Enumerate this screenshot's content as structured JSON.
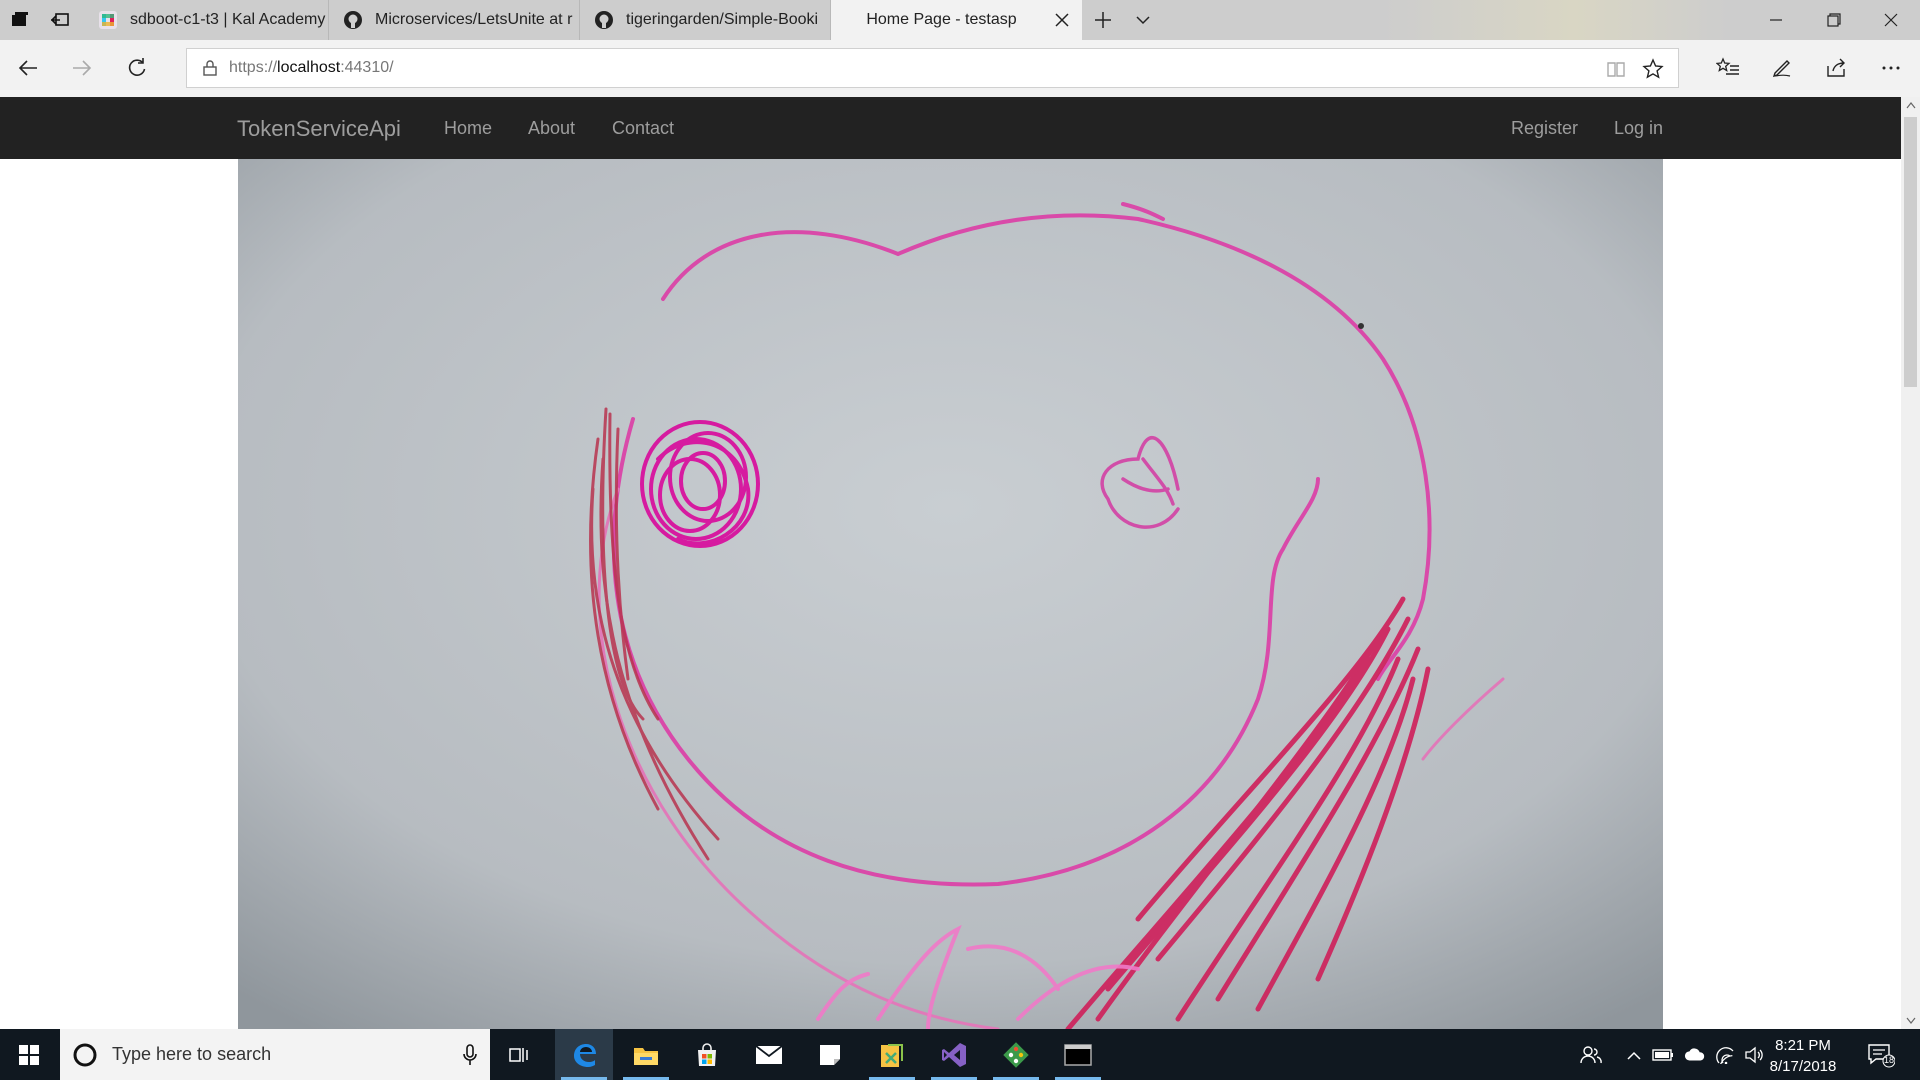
{
  "browser": {
    "tabs": [
      {
        "title": "sdboot-c1-t3 | Kal Academy",
        "favicon": "slack-icon",
        "active": false
      },
      {
        "title": "Microservices/LetsUnite at r",
        "favicon": "github-icon",
        "active": false
      },
      {
        "title": "tigeringarden/Simple-Booki",
        "favicon": "github-icon",
        "active": false
      },
      {
        "title": "Home Page - testasp",
        "favicon": "",
        "active": true
      }
    ],
    "address": {
      "scheme": "https://",
      "host": "localhost",
      "rest": ":44310/"
    }
  },
  "site": {
    "brand": "TokenServiceApi",
    "nav_left": [
      "Home",
      "About",
      "Contact"
    ],
    "nav_right": [
      "Register",
      "Log in"
    ]
  },
  "colors": {
    "navbar_bg": "#222222",
    "nav_text": "#9d9d9d",
    "paper": "#b9bec3",
    "crayon_magenta": "#d81b96",
    "crayon_red": "#cf1f5a",
    "taskbar_bg": "#101820",
    "accent_blue": "#0078d7"
  },
  "taskbar": {
    "search_placeholder": "Type here to search",
    "apps": [
      "task-view-icon",
      "edge-icon",
      "file-explorer-icon",
      "store-icon",
      "mail-icon",
      "sticky-notes-icon",
      "tools-icon",
      "visual-studio-icon",
      "git-icon",
      "terminal-icon"
    ],
    "time": "8:21 PM",
    "date": "8/17/2018",
    "notification_count": "18"
  }
}
